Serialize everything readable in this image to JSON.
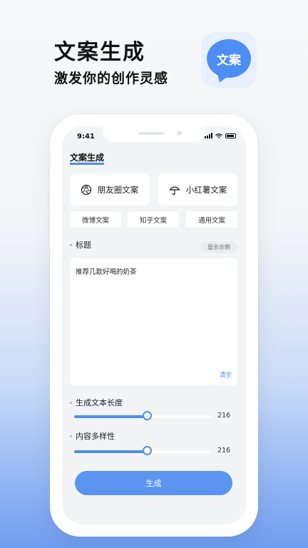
{
  "promo": {
    "headline": "文案生成",
    "subline": "激发你的创作灵感",
    "app_icon_text": "文案"
  },
  "status_bar": {
    "time": "9:41"
  },
  "page": {
    "title": "文案生成"
  },
  "cards": [
    {
      "label": "朋友圈文案",
      "icon": "aperture-icon"
    },
    {
      "label": "小红薯文案",
      "icon": "umbrella-icon"
    }
  ],
  "tabs": [
    {
      "label": "微博文案"
    },
    {
      "label": "知乎文案"
    },
    {
      "label": "通用文案"
    }
  ],
  "title_section": {
    "label": "标题",
    "example_button": "显示示例",
    "input_value": "推荐几款好喝的奶茶",
    "clear_label": "清空"
  },
  "length_slider": {
    "label": "生成文本长度",
    "value": "216",
    "fill_fraction": 0.53
  },
  "diversity_slider": {
    "label": "内容多样性",
    "value": "216",
    "fill_fraction": 0.53
  },
  "generate_button": {
    "label": "生成"
  },
  "colors": {
    "accent": "#4e8df3",
    "button": "#5b95f0"
  }
}
